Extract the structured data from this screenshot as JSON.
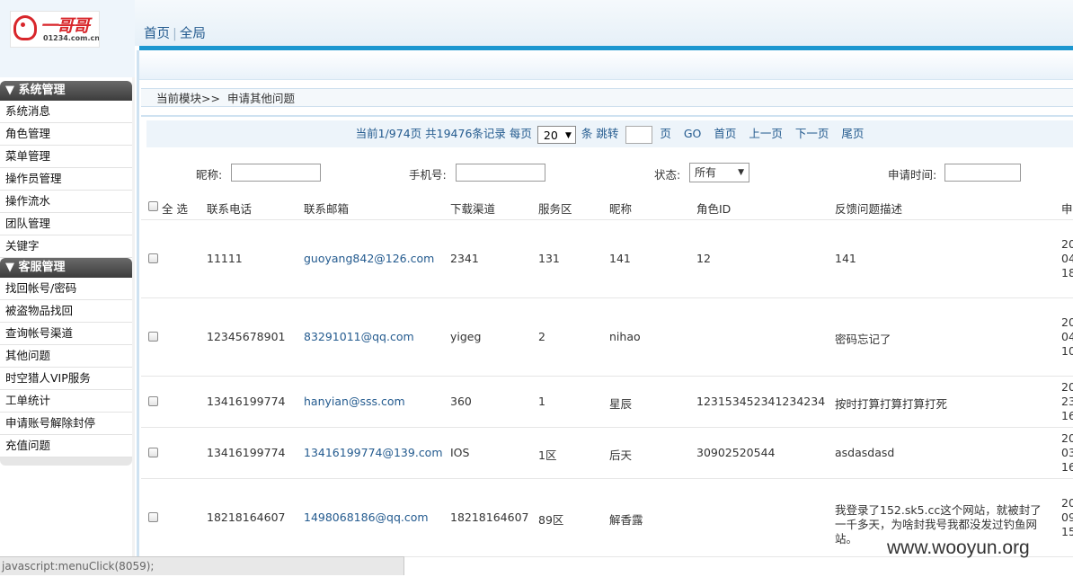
{
  "logo": {
    "brand": "一哥哥",
    "domain": "01234.com.cn"
  },
  "topnav": {
    "home": "首页",
    "sep": "|",
    "global": "全局"
  },
  "sidebar": {
    "groups": [
      {
        "title": "▼ 系统管理",
        "items": [
          "系统消息",
          "角色管理",
          "菜单管理",
          "操作员管理",
          "操作流水",
          "团队管理",
          "关键字"
        ]
      },
      {
        "title": "▼ 客服管理",
        "items": [
          "找回帐号/密码",
          "被盗物品找回",
          "查询帐号渠道",
          "其他问题",
          "时空猎人VIP服务",
          "工单统计",
          "申请账号解除封停",
          "充值问题"
        ]
      }
    ]
  },
  "breadcrumb": {
    "prefix": "当前模块>>",
    "current": "申请其他问题"
  },
  "pager": {
    "info": "当前1/974页 共19476条记录 每页",
    "per_page": "20",
    "unit": "条 跳转",
    "page_unit": "页",
    "go": "GO",
    "first": "首页",
    "prev": "上一页",
    "next": "下一页",
    "last": "尾页"
  },
  "filters": {
    "nickname_label": "昵称:",
    "phone_label": "手机号:",
    "status_label": "状态:",
    "status_value": "所有",
    "time_label": "申请时间:"
  },
  "table": {
    "headers": [
      "全 选",
      "联系电话",
      "联系邮箱",
      "下载渠道",
      "服务区",
      "昵称",
      "角色ID",
      "反馈问题描述",
      "申请"
    ],
    "rows": [
      {
        "phone": "11111",
        "email": "guoyang842@126.com",
        "channel": "2341",
        "server": "131",
        "nickname": "141",
        "role_id": "12",
        "desc": "141",
        "time": [
          "20",
          "04",
          "18"
        ]
      },
      {
        "phone": "12345678901",
        "email": "83291011@qq.com",
        "channel": "yigeg",
        "server": "2",
        "nickname": "nihao",
        "role_id": "",
        "desc": "密码忘记了",
        "time": [
          "20",
          "04",
          "10"
        ]
      },
      {
        "phone": "13416199774",
        "email": "hanyian@sss.com",
        "channel": "360",
        "server": "1",
        "nickname": "星辰",
        "role_id": "123153452341234234",
        "desc": "按时打算打算打算打死",
        "time": [
          "20",
          "23",
          "16"
        ]
      },
      {
        "phone": "13416199774",
        "email": "13416199774@139.com",
        "channel": "IOS",
        "server": "1区",
        "nickname": "后天",
        "role_id": "30902520544",
        "desc": "asdasdasd",
        "time": [
          "20",
          "03",
          "16"
        ]
      },
      {
        "phone": "18218164607",
        "email": "1498068186@qq.com",
        "channel": "18218164607",
        "server": "89区",
        "nickname": "解香露",
        "role_id": "",
        "desc": "我登录了152.sk5.cc这个网站，就被封了一千多天，为啥封我号我都没发过钓鱼网站。",
        "time": [
          "20",
          "09",
          "15"
        ]
      }
    ]
  },
  "statusbar": {
    "text": "javascript:menuClick(8059);"
  },
  "watermark": {
    "text": "www.wooyun.org"
  }
}
